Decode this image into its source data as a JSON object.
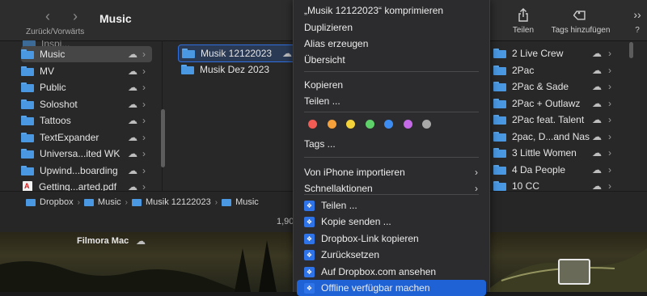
{
  "window": {
    "title": "Music",
    "nav_label": "Zurück/Vorwärts"
  },
  "toolbar": {
    "share_label": "Teilen",
    "tags_label": "Tags hinzufügen",
    "help_label": "?"
  },
  "sidebar_column": {
    "items": [
      {
        "label": "Music",
        "selected": true
      },
      {
        "label": "MV"
      },
      {
        "label": "Public"
      },
      {
        "label": "Soloshot"
      },
      {
        "label": "Tattoos"
      },
      {
        "label": "TextExpander"
      },
      {
        "label": "Universa...ited WK"
      },
      {
        "label": "Upwind...boarding"
      },
      {
        "label": "Getting...arted.pdf",
        "type": "pdf"
      }
    ]
  },
  "middle_column": {
    "items": [
      {
        "label": "Musik 12122023",
        "selected": true
      },
      {
        "label": "Musik Dez 2023"
      }
    ]
  },
  "right_column": {
    "items": [
      {
        "label": "2 Live Crew"
      },
      {
        "label": "2Pac"
      },
      {
        "label": "2Pac & Sade"
      },
      {
        "label": "2Pac + Outlawz"
      },
      {
        "label": "2Pac feat. Talent"
      },
      {
        "label": "2pac, D...and Nas"
      },
      {
        "label": "3 Little Women"
      },
      {
        "label": "4 Da People"
      },
      {
        "label": "10 CC"
      }
    ]
  },
  "pathbar": {
    "segments": [
      "Dropbox",
      "Music",
      "Musik 12122023",
      "Music"
    ]
  },
  "statusbar": {
    "text": "1,90"
  },
  "background": {
    "app_label": "Filmora Mac"
  },
  "context_menu": {
    "items": [
      "„Musik 12122023“ komprimieren",
      "Duplizieren",
      "Alias erzeugen",
      "Übersicht",
      "Kopieren",
      "Teilen ...",
      "Tags ...",
      "Von iPhone importieren",
      "Schnellaktionen",
      "Teilen ...",
      "Kopie senden ...",
      "Dropbox-Link kopieren",
      "Zurücksetzen",
      "Auf Dropbox.com ansehen",
      "Offline verfügbar machen"
    ],
    "tag_colors": [
      "#f25c54",
      "#f5a03a",
      "#f3d23a",
      "#5fd16a",
      "#3c8cf2",
      "#c56ae6",
      "#a8a8a8"
    ]
  }
}
